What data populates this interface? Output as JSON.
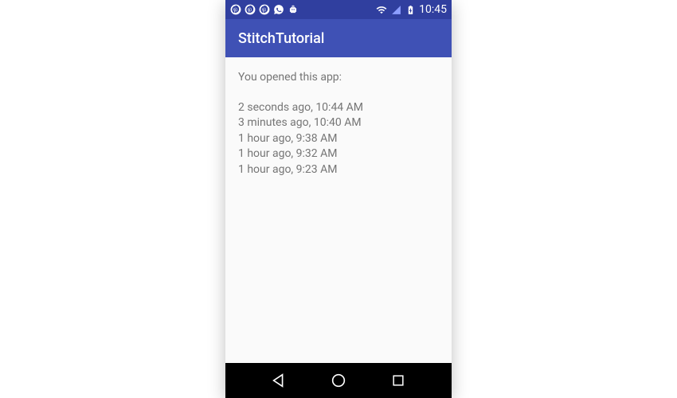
{
  "status_bar": {
    "time": "10:45",
    "icons": {
      "pinterest1": "pinterest",
      "pinterest2": "pinterest",
      "pinterest3": "pinterest",
      "whatsapp": "whatsapp",
      "robot": "robot",
      "wifi": "wifi",
      "signal": "signal",
      "battery": "battery"
    }
  },
  "app_bar": {
    "title": "StitchTutorial"
  },
  "content": {
    "heading": "You opened this app:",
    "log": [
      "2 seconds ago, 10:44 AM",
      "3 minutes ago, 10:40 AM",
      "1 hour ago, 9:38 AM",
      "1 hour ago, 9:32 AM",
      "1 hour ago, 9:23 AM"
    ]
  },
  "nav_bar": {
    "back": "back",
    "home": "home",
    "recent": "recent"
  }
}
